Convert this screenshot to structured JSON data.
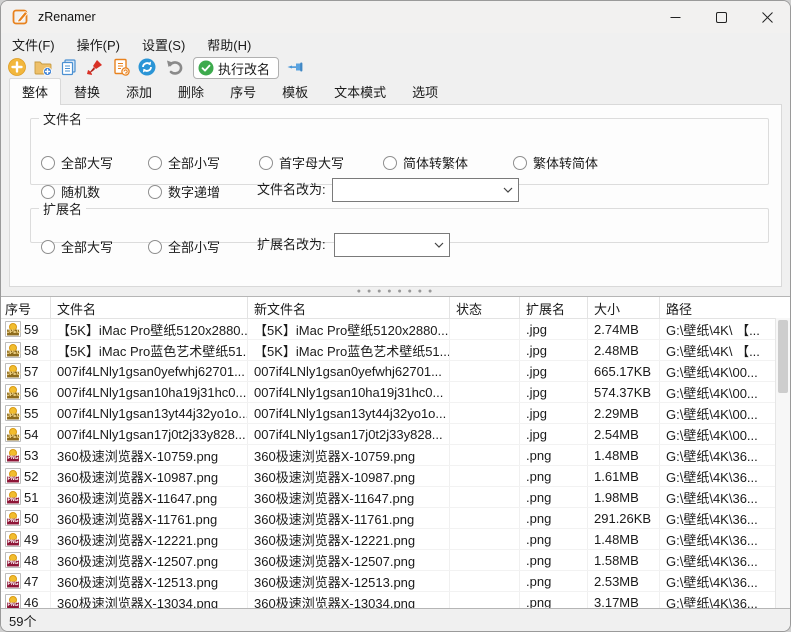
{
  "window": {
    "title": "zRenamer"
  },
  "menu": {
    "items": [
      "文件(F)",
      "操作(P)",
      "设置(S)",
      "帮助(H)"
    ]
  },
  "toolbar": {
    "icon_names": [
      "add-files-icon",
      "add-folder-icon",
      "copy-list-icon",
      "clear-list-icon",
      "rename-preview-icon",
      "refresh-icon",
      "undo-icon",
      "pin-icon"
    ],
    "execute_label": "执行改名"
  },
  "tabs": {
    "items": [
      "整体",
      "替换",
      "添加",
      "删除",
      "序号",
      "模板",
      "文本模式",
      "选项"
    ],
    "selected_index": 0
  },
  "filename_group": {
    "title": "文件名",
    "radios_row1": [
      "全部大写",
      "全部小写",
      "首字母大写",
      "简体转繁体",
      "繁体转简体"
    ],
    "radios_row2": [
      "随机数",
      "数字递增"
    ],
    "rename_label": "文件名改为:",
    "rename_value": ""
  },
  "ext_group": {
    "title": "扩展名",
    "radios": [
      "全部大写",
      "全部小写"
    ],
    "rename_label": "扩展名改为:",
    "rename_value": ""
  },
  "table": {
    "columns": [
      "序号",
      "文件名",
      "新文件名",
      "状态",
      "扩展名",
      "大小",
      "路径"
    ],
    "rows": [
      {
        "num": "59",
        "name": "【5K】iMac Pro壁纸5120x2880...",
        "new_name": "【5K】iMac Pro壁纸5120x2880...",
        "status": "",
        "ext": ".jpg",
        "size": "2.74MB",
        "path": "G:\\壁纸\\4K\\ 【...",
        "type": "jpeg"
      },
      {
        "num": "58",
        "name": "【5K】iMac Pro蓝色艺术壁纸51...",
        "new_name": "【5K】iMac Pro蓝色艺术壁纸51...",
        "status": "",
        "ext": ".jpg",
        "size": "2.48MB",
        "path": "G:\\壁纸\\4K\\ 【...",
        "type": "jpeg"
      },
      {
        "num": "57",
        "name": "007if4LNly1gsan0yefwhj62701...",
        "new_name": "007if4LNly1gsan0yefwhj62701...",
        "status": "",
        "ext": ".jpg",
        "size": "665.17KB",
        "path": "G:\\壁纸\\4K\\00...",
        "type": "jpeg"
      },
      {
        "num": "56",
        "name": "007if4LNly1gsan10ha19j31hc0...",
        "new_name": "007if4LNly1gsan10ha19j31hc0...",
        "status": "",
        "ext": ".jpg",
        "size": "574.37KB",
        "path": "G:\\壁纸\\4K\\00...",
        "type": "jpeg"
      },
      {
        "num": "55",
        "name": "007if4LNly1gsan13yt44j32yo1o...",
        "new_name": "007if4LNly1gsan13yt44j32yo1o...",
        "status": "",
        "ext": ".jpg",
        "size": "2.29MB",
        "path": "G:\\壁纸\\4K\\00...",
        "type": "jpeg"
      },
      {
        "num": "54",
        "name": "007if4LNly1gsan17j0t2j33y828...",
        "new_name": "007if4LNly1gsan17j0t2j33y828...",
        "status": "",
        "ext": ".jpg",
        "size": "2.54MB",
        "path": "G:\\壁纸\\4K\\00...",
        "type": "jpeg"
      },
      {
        "num": "53",
        "name": "360极速浏览器X-10759.png",
        "new_name": "360极速浏览器X-10759.png",
        "status": "",
        "ext": ".png",
        "size": "1.48MB",
        "path": "G:\\壁纸\\4K\\36...",
        "type": "png"
      },
      {
        "num": "52",
        "name": "360极速浏览器X-10987.png",
        "new_name": "360极速浏览器X-10987.png",
        "status": "",
        "ext": ".png",
        "size": "1.61MB",
        "path": "G:\\壁纸\\4K\\36...",
        "type": "png"
      },
      {
        "num": "51",
        "name": "360极速浏览器X-11647.png",
        "new_name": "360极速浏览器X-11647.png",
        "status": "",
        "ext": ".png",
        "size": "1.98MB",
        "path": "G:\\壁纸\\4K\\36...",
        "type": "png"
      },
      {
        "num": "50",
        "name": "360极速浏览器X-11761.png",
        "new_name": "360极速浏览器X-11761.png",
        "status": "",
        "ext": ".png",
        "size": "291.26KB",
        "path": "G:\\壁纸\\4K\\36...",
        "type": "png"
      },
      {
        "num": "49",
        "name": "360极速浏览器X-12221.png",
        "new_name": "360极速浏览器X-12221.png",
        "status": "",
        "ext": ".png",
        "size": "1.48MB",
        "path": "G:\\壁纸\\4K\\36...",
        "type": "png"
      },
      {
        "num": "48",
        "name": "360极速浏览器X-12507.png",
        "new_name": "360极速浏览器X-12507.png",
        "status": "",
        "ext": ".png",
        "size": "1.58MB",
        "path": "G:\\壁纸\\4K\\36...",
        "type": "png"
      },
      {
        "num": "47",
        "name": "360极速浏览器X-12513.png",
        "new_name": "360极速浏览器X-12513.png",
        "status": "",
        "ext": ".png",
        "size": "2.53MB",
        "path": "G:\\壁纸\\4K\\36...",
        "type": "png"
      },
      {
        "num": "46",
        "name": "360极速浏览器X-13034.png",
        "new_name": "360极速浏览器X-13034.png",
        "status": "",
        "ext": ".png",
        "size": "3.17MB",
        "path": "G:\\壁纸\\4K\\36...",
        "type": "png"
      }
    ]
  },
  "statusbar": {
    "count_text": "59个"
  },
  "colors": {
    "accent_orange": "#e8821e",
    "exec_green": "#3daa4d",
    "pin_blue": "#4a97d8",
    "jpeg_badge": "#8d6b1c",
    "png_badge": "#8e1537"
  }
}
